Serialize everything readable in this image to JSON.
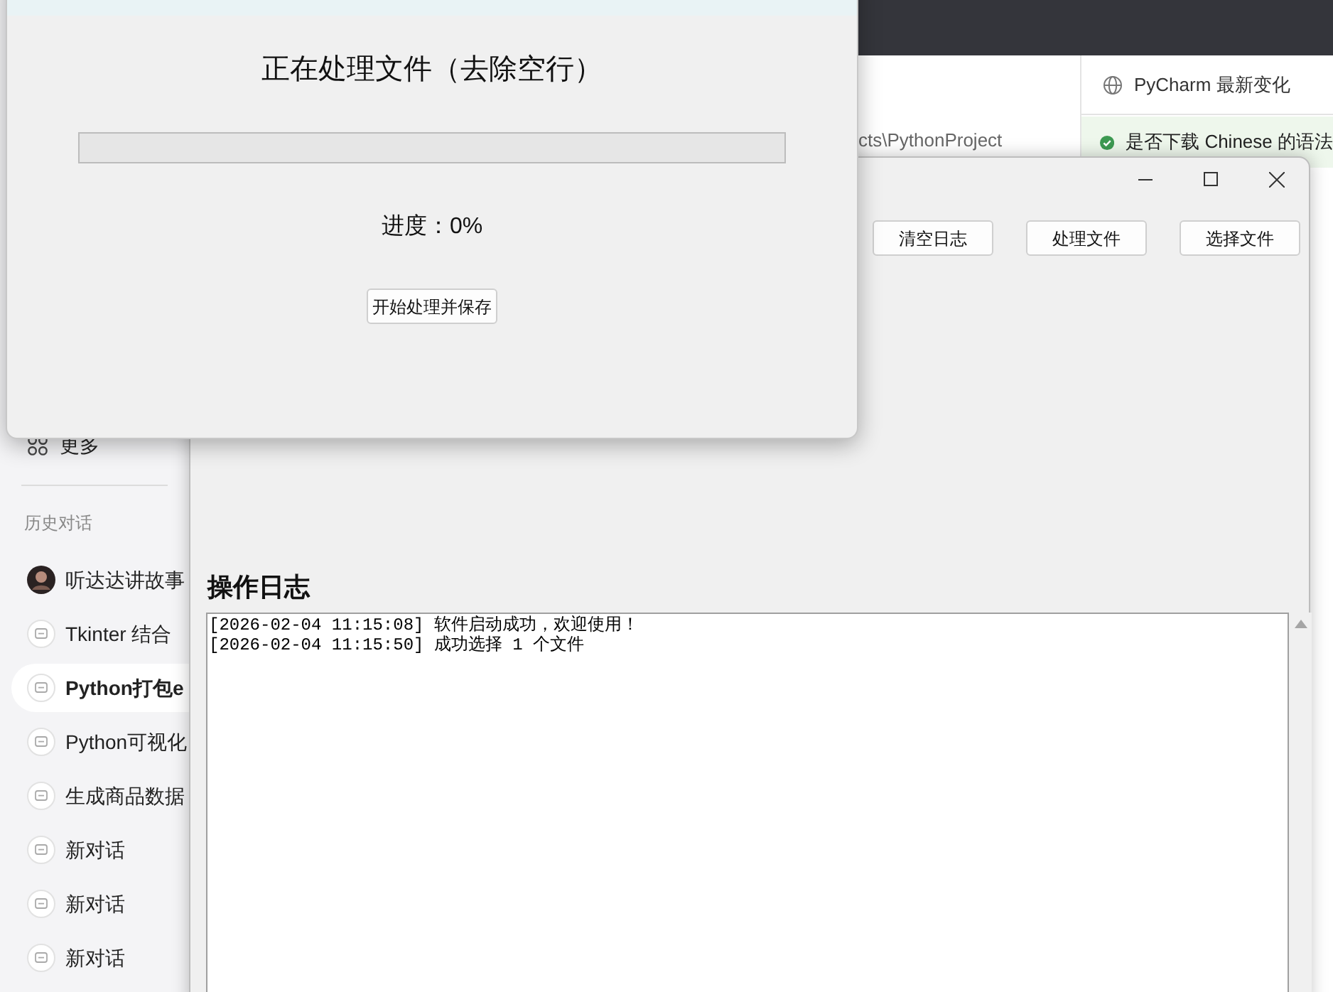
{
  "chat_app": {
    "more_label": "更多",
    "history_heading": "历史对话",
    "conversations": [
      {
        "title": "听达达讲故事",
        "kind": "avatar",
        "selected": false
      },
      {
        "title": "Tkinter 结合",
        "kind": "chat",
        "selected": false
      },
      {
        "title": "Python打包e",
        "kind": "chat",
        "selected": true
      },
      {
        "title": "Python可视化",
        "kind": "chat",
        "selected": false
      },
      {
        "title": "生成商品数据",
        "kind": "chat",
        "selected": false
      },
      {
        "title": "新对话",
        "kind": "chat",
        "selected": false
      },
      {
        "title": "新对话",
        "kind": "chat",
        "selected": false
      },
      {
        "title": "新对话",
        "kind": "chat",
        "selected": false
      }
    ]
  },
  "ide": {
    "path": "cts\\PythonProject",
    "news_tab": "PyCharm 最新变化",
    "notification": "是否下载 Chinese 的语法"
  },
  "main_window": {
    "buttons": [
      "清空日志",
      "处理文件",
      "选择文件"
    ],
    "log_heading": "操作日志",
    "log_lines": [
      "[2026-02-04 11:15:08] 软件启动成功，欢迎使用！",
      "[2026-02-04 11:15:50] 成功选择 1 个文件"
    ]
  },
  "dialog": {
    "title": "正在处理文件（去除空行）",
    "progress": {
      "level": 0
    },
    "progress_text": "进度：0%",
    "button": "开始处理并保存"
  }
}
